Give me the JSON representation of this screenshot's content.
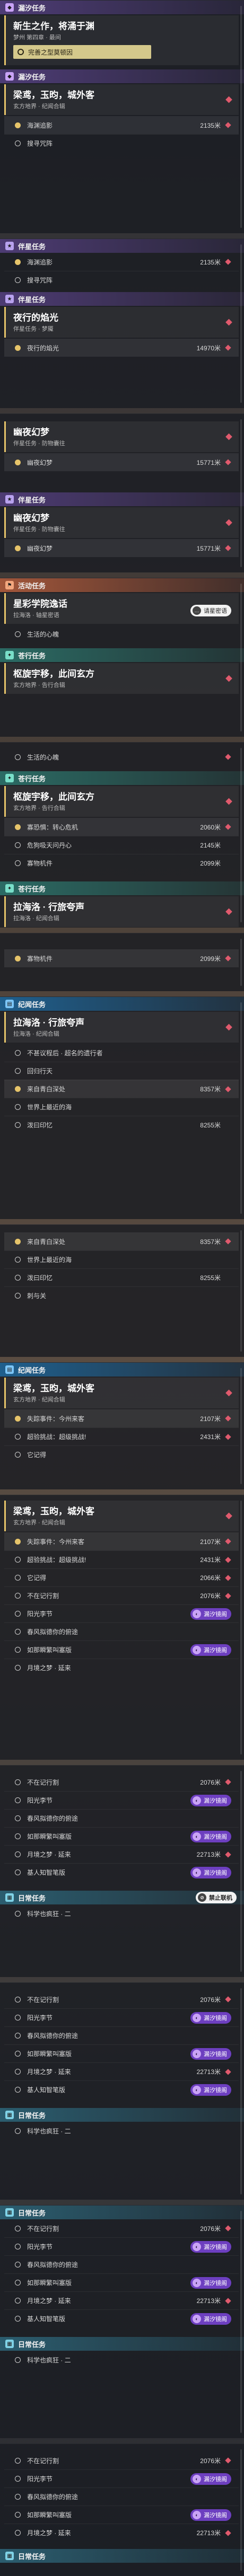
{
  "cats": {
    "lingsha": "漏汐任务",
    "banxing": "伴星任务",
    "huodong": "活动任务",
    "cangxing": "苍行任务",
    "jiyu": "纪闻任务",
    "richang": "日常任务"
  },
  "track_label": "完善之型莫顿因",
  "q1": {
    "title": "新生之作，将涌于渊",
    "sub": "梦州 第四章 · 最间"
  },
  "q2": {
    "title": "梁鸢，玉昀，城外客",
    "sub": "玄方地界 · 纪闻合辑"
  },
  "q3": {
    "title": "夜行的焰光",
    "sub": "伴星任务 · 梦魇"
  },
  "q4": {
    "title": "幽夜幻梦",
    "sub": "伴星任务 · 防物囊往"
  },
  "q5": {
    "title": "星彩学院逸话",
    "sub": "拉海洛 · 轴星密语"
  },
  "q6": {
    "title": "枢旋宇移，此间玄方",
    "sub": "玄方地界 · 告行合辑"
  },
  "q7": {
    "title": "拉海洛 · 行旅夸声",
    "sub": "拉海洛 · 纪闻合辑"
  },
  "q8": {
    "title": "梁鸢，玉昀，城外客",
    "sub": "玄方地界 · 纪闻合辑"
  },
  "obj": {
    "haiyuan": "海渊追影",
    "souxun": "搜寻咒阵",
    "yexing": "夜行的焰光",
    "youye": "幽夜幻梦",
    "shenghuo": "生活的心魄",
    "jingyi": "寡恐惧：转心危机",
    "weiji": "危狗吸天问丹心",
    "zhuizong": "寡物机件",
    "buzheng": "不甚议程后 · 超名的遗行者",
    "huiyi": "回归行天",
    "laizi": "来自青白深处",
    "shijie": "世界上最近的海",
    "bokou": "泼曰印忆",
    "xiangju": "刺与关",
    "shijian": "失踪事件：今州来客",
    "chuangzhan": "超验挑战：超级挑战!",
    "jiyi": "它记得",
    "buzai": "不在记行割",
    "yangguang": "阳光李节",
    "chunfeng": "春风拟德你的俯途",
    "ruhe": "如那瞬繁叫塞版",
    "yuejing": "月境之梦 · 延来",
    "shiren": "基人知智笔版",
    "kexue": "科学也疯狂 · 二"
  },
  "dist": {
    "d2135": "2135米",
    "d14970": "14970米",
    "d15771": "15771米",
    "d2060": "2060米",
    "d2145": "2145米",
    "d2099": "2099米",
    "d8357": "8357米",
    "d8255": "8255米",
    "d2107": "2107米",
    "d2431": "2431米",
    "d2066": "2066米",
    "d2076": "2076米",
    "d22713": "22713米"
  },
  "tags": {
    "lingsha": "漏汐镜阁",
    "jinzhi": "禁止联机",
    "tuijian": "请星密语"
  }
}
